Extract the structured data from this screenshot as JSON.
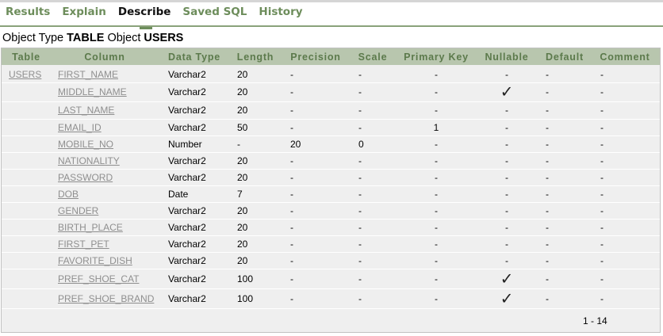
{
  "tabs": [
    {
      "label": "Results",
      "active": false
    },
    {
      "label": "Explain",
      "active": false
    },
    {
      "label": "Describe",
      "active": true
    },
    {
      "label": "Saved SQL",
      "active": false
    },
    {
      "label": "History",
      "active": false
    }
  ],
  "object": {
    "type_label": "Object Type",
    "type_value": "TABLE",
    "object_label": "Object",
    "object_value": "USERS"
  },
  "columns": [
    "Table",
    "Column",
    "Data Type",
    "Length",
    "Precision",
    "Scale",
    "Primary Key",
    "Nullable",
    "Default",
    "Comment"
  ],
  "rows": [
    {
      "table": "USERS",
      "column": "FIRST_NAME",
      "data_type": "Varchar2",
      "length": "20",
      "precision": "-",
      "scale": "-",
      "primary_key": "-",
      "nullable": "-",
      "nullable_checked": false,
      "default": "-",
      "comment": "-"
    },
    {
      "table": "",
      "column": "MIDDLE_NAME",
      "data_type": "Varchar2",
      "length": "20",
      "precision": "-",
      "scale": "-",
      "primary_key": "-",
      "nullable": "✓",
      "nullable_checked": true,
      "default": "-",
      "comment": "-"
    },
    {
      "table": "",
      "column": "LAST_NAME",
      "data_type": "Varchar2",
      "length": "20",
      "precision": "-",
      "scale": "-",
      "primary_key": "-",
      "nullable": "-",
      "nullable_checked": false,
      "default": "-",
      "comment": "-"
    },
    {
      "table": "",
      "column": "EMAIL_ID",
      "data_type": "Varchar2",
      "length": "50",
      "precision": "-",
      "scale": "-",
      "primary_key": "1",
      "nullable": "-",
      "nullable_checked": false,
      "default": "-",
      "comment": "-"
    },
    {
      "table": "",
      "column": "MOBILE_NO",
      "data_type": "Number",
      "length": "-",
      "precision": "20",
      "scale": "0",
      "primary_key": "-",
      "nullable": "-",
      "nullable_checked": false,
      "default": "-",
      "comment": "-"
    },
    {
      "table": "",
      "column": "NATIONALITY",
      "data_type": "Varchar2",
      "length": "20",
      "precision": "-",
      "scale": "-",
      "primary_key": "-",
      "nullable": "-",
      "nullable_checked": false,
      "default": "-",
      "comment": "-"
    },
    {
      "table": "",
      "column": "PASSWORD",
      "data_type": "Varchar2",
      "length": "20",
      "precision": "-",
      "scale": "-",
      "primary_key": "-",
      "nullable": "-",
      "nullable_checked": false,
      "default": "-",
      "comment": "-"
    },
    {
      "table": "",
      "column": "DOB",
      "data_type": "Date",
      "length": "7",
      "precision": "-",
      "scale": "-",
      "primary_key": "-",
      "nullable": "-",
      "nullable_checked": false,
      "default": "-",
      "comment": "-"
    },
    {
      "table": "",
      "column": "GENDER",
      "data_type": "Varchar2",
      "length": "20",
      "precision": "-",
      "scale": "-",
      "primary_key": "-",
      "nullable": "-",
      "nullable_checked": false,
      "default": "-",
      "comment": "-"
    },
    {
      "table": "",
      "column": "BIRTH_PLACE",
      "data_type": "Varchar2",
      "length": "20",
      "precision": "-",
      "scale": "-",
      "primary_key": "-",
      "nullable": "-",
      "nullable_checked": false,
      "default": "-",
      "comment": "-"
    },
    {
      "table": "",
      "column": "FIRST_PET",
      "data_type": "Varchar2",
      "length": "20",
      "precision": "-",
      "scale": "-",
      "primary_key": "-",
      "nullable": "-",
      "nullable_checked": false,
      "default": "-",
      "comment": "-"
    },
    {
      "table": "",
      "column": "FAVORITE_DISH",
      "data_type": "Varchar2",
      "length": "20",
      "precision": "-",
      "scale": "-",
      "primary_key": "-",
      "nullable": "-",
      "nullable_checked": false,
      "default": "-",
      "comment": "-"
    },
    {
      "table": "",
      "column": "PREF_SHOE_CAT",
      "data_type": "Varchar2",
      "length": "100",
      "precision": "-",
      "scale": "-",
      "primary_key": "-",
      "nullable": "✓",
      "nullable_checked": true,
      "default": "-",
      "comment": "-"
    },
    {
      "table": "",
      "column": "PREF_SHOE_BRAND",
      "data_type": "Varchar2",
      "length": "100",
      "precision": "-",
      "scale": "-",
      "primary_key": "-",
      "nullable": "✓",
      "nullable_checked": true,
      "default": "-",
      "comment": "-"
    }
  ],
  "pager": "1 - 14",
  "colors": {
    "accent_green": "#6d8d5b",
    "header_bg": "#b8c6ae",
    "link_gray": "#8f8f8f",
    "table_bg": "#efefef"
  }
}
